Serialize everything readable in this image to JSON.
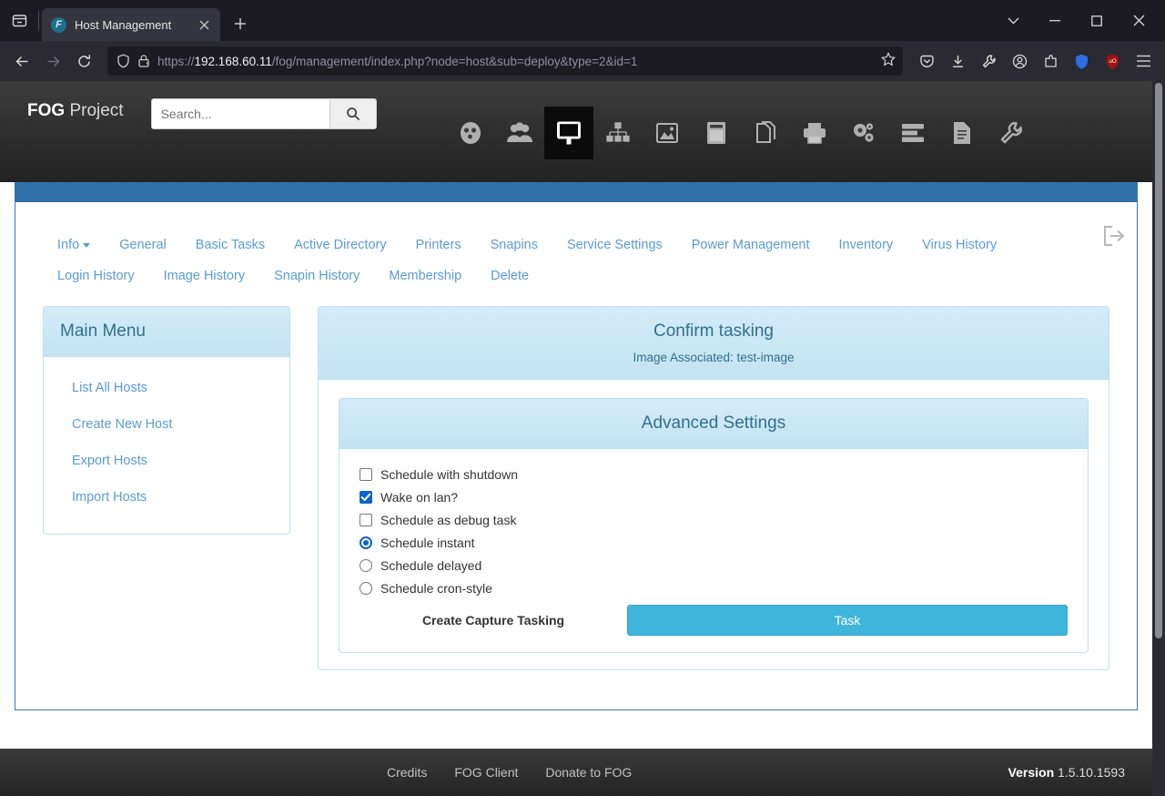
{
  "browser": {
    "tab_list_icon": "tab-list-icon",
    "tab": {
      "favicon_letter": "F",
      "title": "Host Management",
      "close_icon": "close-icon"
    },
    "new_tab_label": "+",
    "window_controls": {
      "tablist": "chevron-down-icon",
      "minimize": "minimize-icon",
      "maximize": "maximize-icon",
      "close": "close-icon"
    },
    "nav": {
      "back": "back-arrow-icon",
      "forward": "forward-arrow-icon",
      "reload": "reload-icon"
    },
    "url": {
      "shield_icon": "shield-icon",
      "lock_icon": "lock-warning-icon",
      "prefix": "https://",
      "host": "192.168.60.11",
      "path": "/fog/management/index.php?node=host&sub=deploy&type=2&id=1",
      "bookmark_icon": "star-icon"
    },
    "toolbar_icons": [
      "pocket-icon",
      "downloads-icon",
      "wrench-icon",
      "account-icon",
      "extensions-icon",
      "shield-blue-icon",
      "ublock-icon",
      "menu-icon"
    ],
    "ublock_badge": "uO"
  },
  "header": {
    "brand_bold": "FOG",
    "brand_rest": " Project",
    "search": {
      "placeholder": "Search...",
      "value": "",
      "button_icon": "search-icon"
    },
    "nav_icons": [
      {
        "name": "dashboard-icon",
        "glyph": "dashboard",
        "active": false
      },
      {
        "name": "users-icon",
        "glyph": "users",
        "active": false
      },
      {
        "name": "host-management-icon",
        "glyph": "monitor",
        "active": true
      },
      {
        "name": "group-management-icon",
        "glyph": "sitemap",
        "active": false
      },
      {
        "name": "image-management-icon",
        "glyph": "image",
        "active": false
      },
      {
        "name": "storage-management-icon",
        "glyph": "storage",
        "active": false
      },
      {
        "name": "snapin-management-icon",
        "glyph": "snapin",
        "active": false
      },
      {
        "name": "printer-management-icon",
        "glyph": "printer",
        "active": false
      },
      {
        "name": "service-configuration-icon",
        "glyph": "gears",
        "active": false
      },
      {
        "name": "task-management-icon",
        "glyph": "tasks",
        "active": false
      },
      {
        "name": "report-management-icon",
        "glyph": "report",
        "active": false
      },
      {
        "name": "fog-configuration-icon",
        "glyph": "wrench",
        "active": false
      }
    ],
    "logout_icon": "logout-icon"
  },
  "tabs": [
    {
      "label": "Info",
      "caret": true
    },
    {
      "label": "General",
      "caret": false
    },
    {
      "label": "Basic Tasks",
      "caret": false
    },
    {
      "label": "Active Directory",
      "caret": false
    },
    {
      "label": "Printers",
      "caret": false
    },
    {
      "label": "Snapins",
      "caret": false
    },
    {
      "label": "Service Settings",
      "caret": false
    },
    {
      "label": "Power Management",
      "caret": false
    },
    {
      "label": "Inventory",
      "caret": false
    },
    {
      "label": "Virus History",
      "caret": false
    },
    {
      "label": "Login History",
      "caret": false
    },
    {
      "label": "Image History",
      "caret": false
    },
    {
      "label": "Snapin History",
      "caret": false
    },
    {
      "label": "Membership",
      "caret": false
    },
    {
      "label": "Delete",
      "caret": false
    }
  ],
  "sidebar": {
    "title": "Main Menu",
    "items": [
      {
        "label": "List All Hosts"
      },
      {
        "label": "Create New Host"
      },
      {
        "label": "Export Hosts"
      },
      {
        "label": "Import Hosts"
      }
    ]
  },
  "main": {
    "title": "Confirm tasking",
    "subtitle": "Image Associated: test-image",
    "advanced": {
      "title": "Advanced Settings",
      "options": [
        {
          "type": "checkbox",
          "label": "Schedule with shutdown",
          "checked": false,
          "name": "schedule-with-shutdown"
        },
        {
          "type": "checkbox",
          "label": "Wake on lan?",
          "checked": true,
          "name": "wake-on-lan"
        },
        {
          "type": "checkbox",
          "label": "Schedule as debug task",
          "checked": false,
          "name": "schedule-as-debug-task"
        },
        {
          "type": "radio",
          "label": "Schedule instant",
          "checked": true,
          "name": "schedule-instant"
        },
        {
          "type": "radio",
          "label": "Schedule delayed",
          "checked": false,
          "name": "schedule-delayed"
        },
        {
          "type": "radio",
          "label": "Schedule cron-style",
          "checked": false,
          "name": "schedule-cron-style"
        }
      ],
      "action_label": "Create Capture Tasking",
      "action_button": "Task"
    }
  },
  "footer": {
    "links": [
      "Credits",
      "FOG Client",
      "Donate to FOG"
    ],
    "version_label": "Version",
    "version_number": "1.5.10.1593"
  },
  "colors": {
    "accent_blue": "#3071a9",
    "link_blue": "#5a9bd5",
    "panel_blue": "#c3e3f2",
    "task_button": "#3fb5dc",
    "checkbox_checked": "#0b63ce"
  }
}
